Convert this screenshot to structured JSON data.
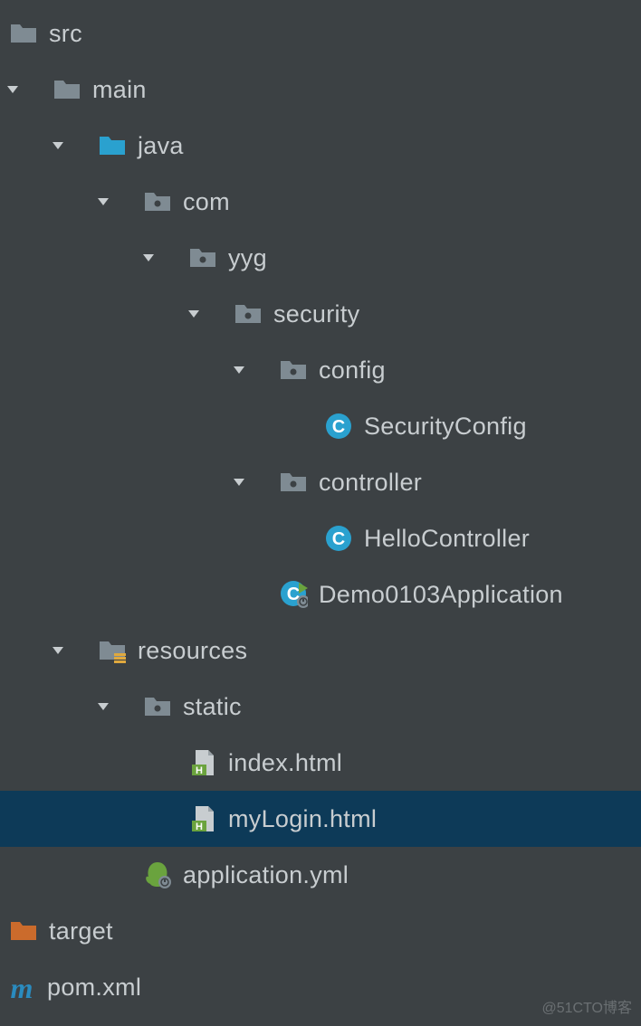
{
  "tree": {
    "src": "src",
    "main": "main",
    "java": "java",
    "com": "com",
    "yyg": "yyg",
    "security": "security",
    "config": "config",
    "security_config": "SecurityConfig",
    "controller": "controller",
    "hello_controller": "HelloController",
    "demo_app": "Demo0103Application",
    "resources": "resources",
    "static": "static",
    "index_html": "index.html",
    "mylogin_html": "myLogin.html",
    "application_yml": "application.yml",
    "target": "target",
    "pom_xml": "pom.xml"
  },
  "watermark": "@51CTO博客",
  "colors": {
    "bg": "#3c4144",
    "selected": "#0d3a58",
    "folder_gray": "#7f8b93",
    "folder_blue": "#2aa1cf",
    "folder_orange": "#cb6b2c",
    "class_blue": "#2aa1cf",
    "html_green": "#6ba33e",
    "spring_green": "#6aa33e",
    "maven_blue": "#2a8bbf"
  }
}
